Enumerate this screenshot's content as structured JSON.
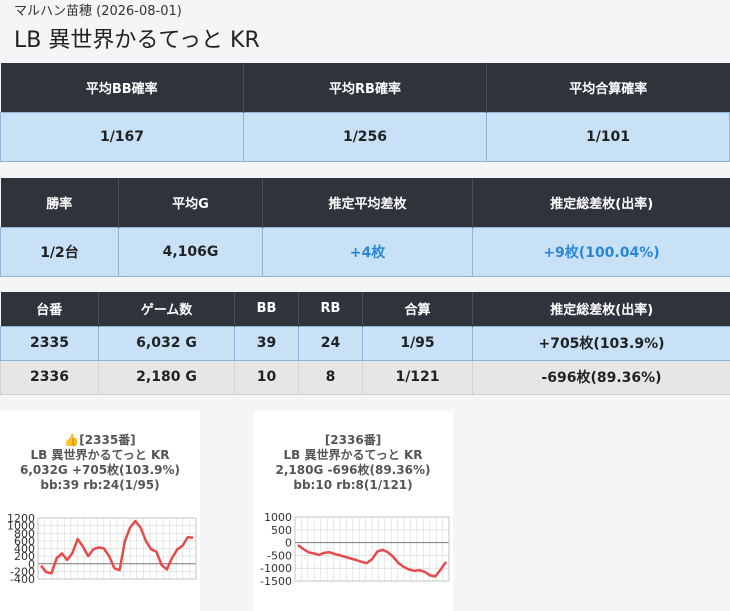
{
  "header": {
    "store": "マルハン苗穂 (2026-08-01)",
    "title": "LB 異世界かるてっと KR"
  },
  "summary1": {
    "headers": [
      "平均BB確率",
      "平均RB確率",
      "平均合算確率"
    ],
    "values": [
      "1/167",
      "1/256",
      "1/101"
    ]
  },
  "summary2": {
    "headers": [
      "勝率",
      "平均G",
      "推定平均差枚",
      "推定総差枚(出率)"
    ],
    "values": [
      "1/2台",
      "4,106G",
      "+4枚",
      "+9枚(100.04%)"
    ]
  },
  "machines": {
    "headers": [
      "台番",
      "ゲーム数",
      "BB",
      "RB",
      "合算",
      "推定総差枚(出率)"
    ],
    "rows": [
      [
        "2335",
        "6,032 G",
        "39",
        "24",
        "1/95",
        "+705枚(103.9%)"
      ],
      [
        "2336",
        "2,180 G",
        "10",
        "8",
        "1/121",
        "-696枚(89.36%)"
      ]
    ]
  },
  "charts": [
    {
      "caption": [
        "👍[2335番]",
        "LB 異世界かるてっと KR",
        "6,032G +705枚(103.9%)",
        "bb:39 rb:24(1/95)"
      ],
      "color": "#e84a4a"
    },
    {
      "caption": [
        "[2336番]",
        "LB 異世界かるてっと KR",
        "2,180G -696枚(89.36%)",
        "bb:10 rb:8(1/121)"
      ],
      "color": "#e84a4a"
    }
  ],
  "chart_data": [
    {
      "type": "line",
      "yticks": [
        "1200",
        "1000",
        "800",
        "600",
        "400",
        "200",
        "0",
        "-200",
        "-400"
      ],
      "ylim": [
        -400,
        1200
      ],
      "values": [
        -50,
        -220,
        -250,
        150,
        270,
        100,
        280,
        650,
        450,
        200,
        380,
        430,
        400,
        200,
        -120,
        -170,
        600,
        950,
        1120,
        950,
        600,
        380,
        320,
        -30,
        -150,
        150,
        380,
        470,
        700,
        680
      ],
      "series": [
        {
          "values": [
            -50,
            -220,
            -250,
            150,
            270,
            100,
            280,
            650,
            450,
            200,
            380,
            430,
            400,
            200,
            -120,
            -170,
            600,
            950,
            1120,
            950,
            600,
            380,
            320,
            -30,
            -150,
            150,
            380,
            470,
            700,
            680
          ]
        }
      ]
    },
    {
      "type": "line",
      "yticks": [
        "1000",
        "500",
        "0",
        "-500",
        "-1000",
        "-1500"
      ],
      "ylim": [
        -1500,
        1000
      ],
      "values": [
        -100,
        -250,
        -380,
        -420,
        -480,
        -400,
        -380,
        -450,
        -500,
        -560,
        -620,
        -680,
        -750,
        -800,
        -650,
        -350,
        -280,
        -380,
        -550,
        -800,
        -950,
        -1050,
        -1100,
        -1080,
        -1150,
        -1280,
        -1320,
        -1050,
        -750
      ],
      "series": [
        {
          "values": [
            -100,
            -250,
            -380,
            -420,
            -480,
            -400,
            -380,
            -450,
            -500,
            -560,
            -620,
            -680,
            -750,
            -800,
            -650,
            -350,
            -280,
            -380,
            -550,
            -800,
            -950,
            -1050,
            -1100,
            -1080,
            -1150,
            -1280,
            -1320,
            -1050,
            -750
          ]
        }
      ]
    }
  ]
}
